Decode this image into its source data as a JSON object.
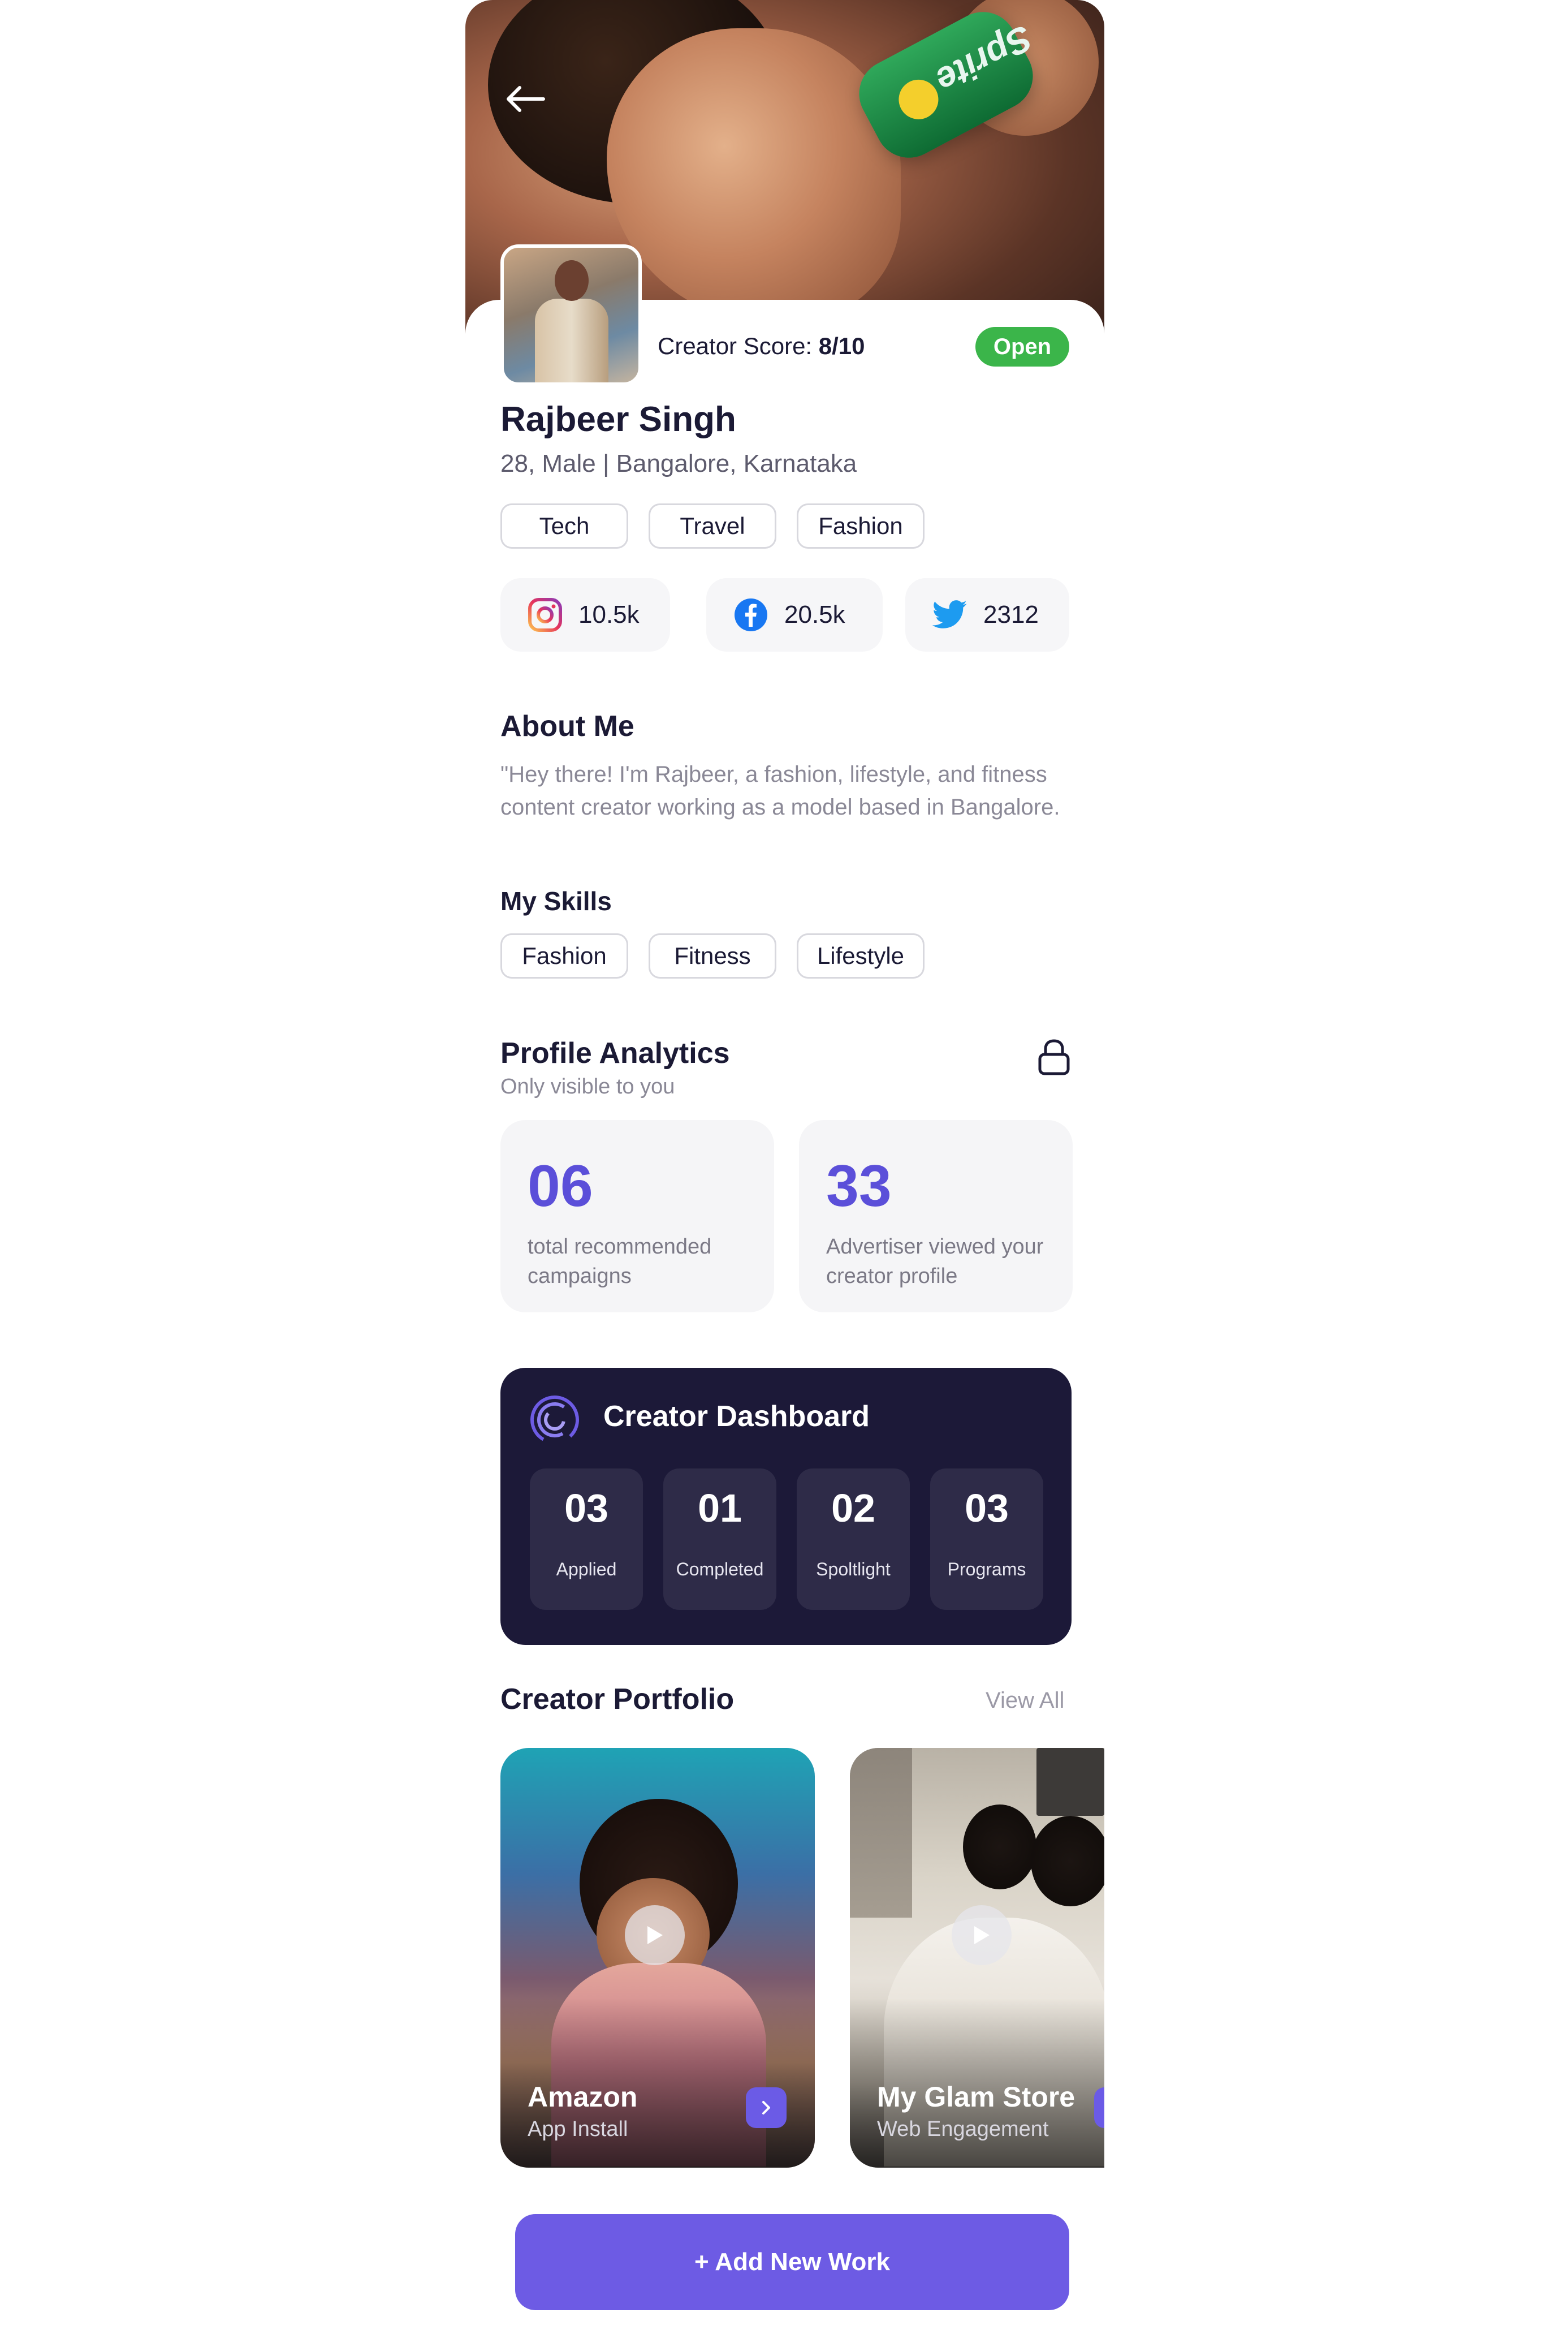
{
  "profile": {
    "creator_score_label": "Creator Score:",
    "creator_score_value": "8/10",
    "status": "Open",
    "name": "Rajbeer Singh",
    "meta": "28, Male  |  Bangalore, Karnataka",
    "categories": [
      "Tech",
      "Travel",
      "Fashion"
    ]
  },
  "socials": [
    {
      "icon": "instagram-icon",
      "value": "10.5k"
    },
    {
      "icon": "facebook-icon",
      "value": "20.5k"
    },
    {
      "icon": "twitter-icon",
      "value": "2312"
    }
  ],
  "about": {
    "title": "About Me",
    "text": "\"Hey there! I'm Rajbeer, a fashion, lifestyle, and fitness content creator working as a model based in Bangalore."
  },
  "skills": {
    "title": "My Skills",
    "items": [
      "Fashion",
      "Fitness",
      "Lifestyle"
    ]
  },
  "analytics": {
    "title": "Profile Analytics",
    "subtitle": "Only visible to you",
    "stats": [
      {
        "value": "06",
        "label": "total recommended campaigns"
      },
      {
        "value": "33",
        "label": "Advertiser viewed your creator profile"
      }
    ]
  },
  "dashboard": {
    "title": "Creator Dashboard",
    "tiles": [
      {
        "value": "03",
        "label": "Applied"
      },
      {
        "value": "01",
        "label": "Completed"
      },
      {
        "value": "02",
        "label": "Spoltlight"
      },
      {
        "value": "03",
        "label": "Programs"
      }
    ]
  },
  "portfolio": {
    "title": "Creator Portfolio",
    "view_all": "View All",
    "items": [
      {
        "title": "Amazon",
        "subtitle": "App Install"
      },
      {
        "title": "My Glam Store",
        "subtitle": "Web Engagement"
      }
    ]
  },
  "actions": {
    "add_new_work": "+ Add New Work"
  },
  "colors": {
    "accent": "#6d5be4",
    "status_open": "#3bb54a",
    "dashboard_bg": "#1c1938",
    "stat_number": "#5b4fd9"
  }
}
